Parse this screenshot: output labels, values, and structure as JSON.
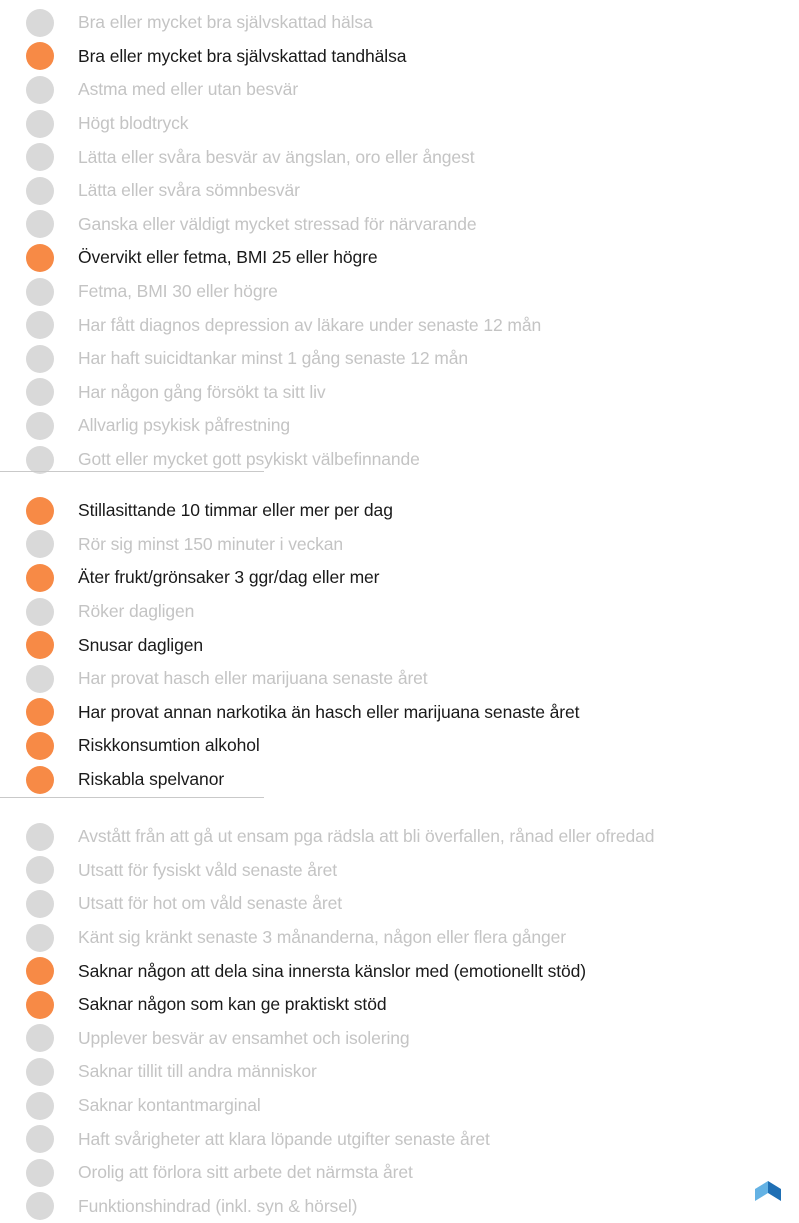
{
  "colors": {
    "highlight": "#f78a46",
    "inactive": "#d9d9d9",
    "text_active": "#1a1a1a",
    "text_muted": "#c4c4c4"
  },
  "groups": [
    {
      "items": [
        {
          "label": "Bra eller mycket bra självskattad hälsa",
          "highlighted": false
        },
        {
          "label": "Bra eller mycket bra självskattad tandhälsa",
          "highlighted": true
        },
        {
          "label": "Astma med eller utan besvär",
          "highlighted": false
        },
        {
          "label": "Högt blodtryck",
          "highlighted": false
        },
        {
          "label": "Lätta eller svåra besvär av ängslan, oro eller ångest",
          "highlighted": false
        },
        {
          "label": "Lätta eller svåra sömnbesvär",
          "highlighted": false
        },
        {
          "label": "Ganska eller väldigt mycket stressad för närvarande",
          "highlighted": false
        },
        {
          "label": "Övervikt eller fetma, BMI 25 eller högre",
          "highlighted": true
        },
        {
          "label": "Fetma, BMI 30 eller högre",
          "highlighted": false
        },
        {
          "label": "Har fått diagnos depression av läkare under senaste 12 mån",
          "highlighted": false
        },
        {
          "label": "Har haft suicidtankar minst 1 gång senaste 12 mån",
          "highlighted": false
        },
        {
          "label": "Har någon gång försökt ta sitt liv",
          "highlighted": false
        },
        {
          "label": "Allvarlig psykisk påfrestning",
          "highlighted": false
        },
        {
          "label": "Gott eller mycket gott psykiskt välbefinnande",
          "highlighted": false
        }
      ]
    },
    {
      "items": [
        {
          "label": "Stillasittande 10 timmar eller mer per dag",
          "highlighted": true
        },
        {
          "label": "Rör sig minst 150 minuter i veckan",
          "highlighted": false
        },
        {
          "label": "Äter frukt/grönsaker 3 ggr/dag eller mer",
          "highlighted": true
        },
        {
          "label": "Röker dagligen",
          "highlighted": false
        },
        {
          "label": "Snusar dagligen",
          "highlighted": true
        },
        {
          "label": "Har provat hasch eller marijuana senaste året",
          "highlighted": false
        },
        {
          "label": "Har provat annan narkotika än hasch eller marijuana senaste året",
          "highlighted": true
        },
        {
          "label": "Riskkonsumtion alkohol",
          "highlighted": true
        },
        {
          "label": "Riskabla spelvanor",
          "highlighted": true
        }
      ]
    },
    {
      "items": [
        {
          "label": "Avstått från att gå ut ensam pga rädsla att bli överfallen, rånad eller ofredad",
          "highlighted": false
        },
        {
          "label": "Utsatt för fysiskt våld senaste året",
          "highlighted": false
        },
        {
          "label": "Utsatt för hot om våld senaste året",
          "highlighted": false
        },
        {
          "label": "Känt sig kränkt senaste 3 månanderna, någon eller flera gånger",
          "highlighted": false
        },
        {
          "label": "Saknar någon att dela sina innersta känslor med (emotionellt stöd)",
          "highlighted": true
        },
        {
          "label": "Saknar någon som kan ge praktiskt stöd",
          "highlighted": true
        },
        {
          "label": "Upplever besvär av ensamhet och isolering",
          "highlighted": false
        },
        {
          "label": "Saknar tillit till andra människor",
          "highlighted": false
        },
        {
          "label": "Saknar kontantmarginal",
          "highlighted": false
        },
        {
          "label": "Haft svårigheter att klara löpande utgifter senaste året",
          "highlighted": false
        },
        {
          "label": "Orolig att förlora sitt arbete det närmsta året",
          "highlighted": false
        },
        {
          "label": "Funktionshindrad (inkl. syn & hörsel)",
          "highlighted": false
        }
      ]
    }
  ],
  "logo": {
    "icon": "brand-logo-icon"
  }
}
